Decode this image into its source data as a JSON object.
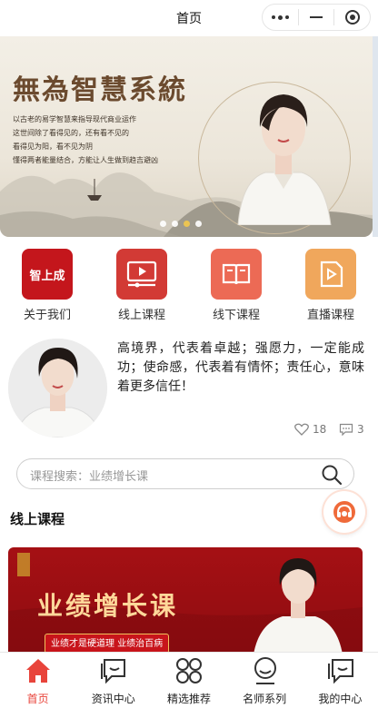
{
  "nav": {
    "title": "首页"
  },
  "banner": {
    "title": "無為智慧系統",
    "lines": [
      "以古老的易学智慧来指导现代商业运作",
      "这世间除了看得见的，还有看不见的",
      "看得见为阳，看不见为阴",
      "懂得两者能量结合，方能让人生做到趋吉避凶"
    ],
    "slide_count": 4,
    "active_slide": 2
  },
  "categories": [
    {
      "label": "关于我们",
      "icon": "brand-logo-icon",
      "color": "#c4161c",
      "logo_text": "智上成"
    },
    {
      "label": "线上课程",
      "icon": "video-play-icon",
      "color": "#d23a35"
    },
    {
      "label": "线下课程",
      "icon": "open-book-icon",
      "color": "#ec6a55"
    },
    {
      "label": "直播课程",
      "icon": "live-video-icon",
      "color": "#f0a75c"
    }
  ],
  "intro": {
    "text": "高境界，代表着卓越；强愿力，一定能成功；使命感，代表着有情怀；责任心，意味着更多信任！",
    "likes": "18",
    "comments": "3"
  },
  "search": {
    "placeholder": "课程搜索：业绩增长课"
  },
  "section": {
    "title": "线上课程"
  },
  "course": {
    "title": "业绩增长课",
    "subtitle": "业绩才是硬道理 业绩治百病"
  },
  "tabs": [
    {
      "label": "首页",
      "icon": "home-icon",
      "active": true
    },
    {
      "label": "资讯中心",
      "icon": "chat-icon",
      "active": false
    },
    {
      "label": "精选推荐",
      "icon": "grid-icon",
      "active": false
    },
    {
      "label": "名师系列",
      "icon": "teacher-icon",
      "active": false
    },
    {
      "label": "我的中心",
      "icon": "profile-icon",
      "active": false
    }
  ],
  "colors": {
    "accent": "#e8443b",
    "gold": "#f3c94b",
    "course_red": "#a51014"
  }
}
